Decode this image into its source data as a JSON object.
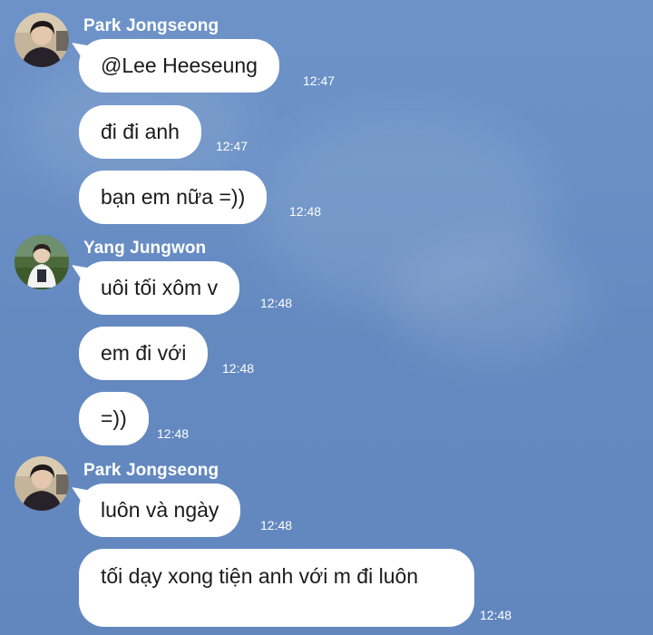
{
  "chat": {
    "groups": [
      {
        "sender": "Park Jongseong",
        "avatar": "profile-photo-park-jongseong",
        "messages": [
          {
            "text": "@Lee Heeseung",
            "time": "12:47"
          },
          {
            "text": "đi đi anh",
            "time": "12:47"
          },
          {
            "text": "bạn em nữa =))",
            "time": "12:48"
          }
        ]
      },
      {
        "sender": "Yang Jungwon",
        "avatar": "profile-photo-yang-jungwon",
        "messages": [
          {
            "text": "uôi tối xôm v",
            "time": "12:48"
          },
          {
            "text": "em đi với",
            "time": "12:48"
          },
          {
            "text": "=))",
            "time": "12:48"
          }
        ]
      },
      {
        "sender": "Park Jongseong",
        "avatar": "profile-photo-park-jongseong",
        "messages": [
          {
            "text": "luôn và ngày",
            "time": "12:48"
          },
          {
            "text": "tối dạy xong tiện anh với m đi luôn",
            "time": "12:48"
          }
        ]
      }
    ]
  },
  "theme": {
    "background": "#6a8fc5",
    "bubble": "#ffffff",
    "text": "#1b1b1b",
    "meta_text": "#ffffff"
  }
}
